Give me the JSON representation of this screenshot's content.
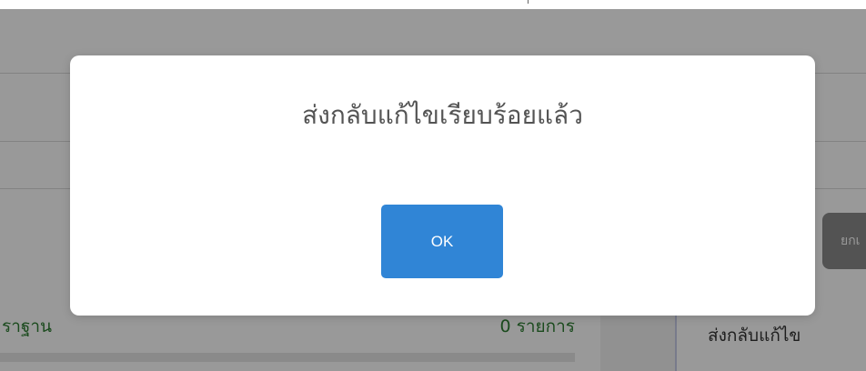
{
  "dialog": {
    "title": "ส่งกลับแก้ไขเรียบร้อยแล้ว",
    "ok_label": "OK"
  },
  "background": {
    "cancel_button_label": "ยกเ",
    "left_card": {
      "title": "ราฐาน",
      "count": "0 รายการ"
    },
    "right_card": {
      "title": "ส่งกลับแก้ไข"
    }
  },
  "colors": {
    "ok_button": "#3085d6",
    "overlay": "rgba(0,0,0,0.40)",
    "count_text": "#2e7d32"
  }
}
